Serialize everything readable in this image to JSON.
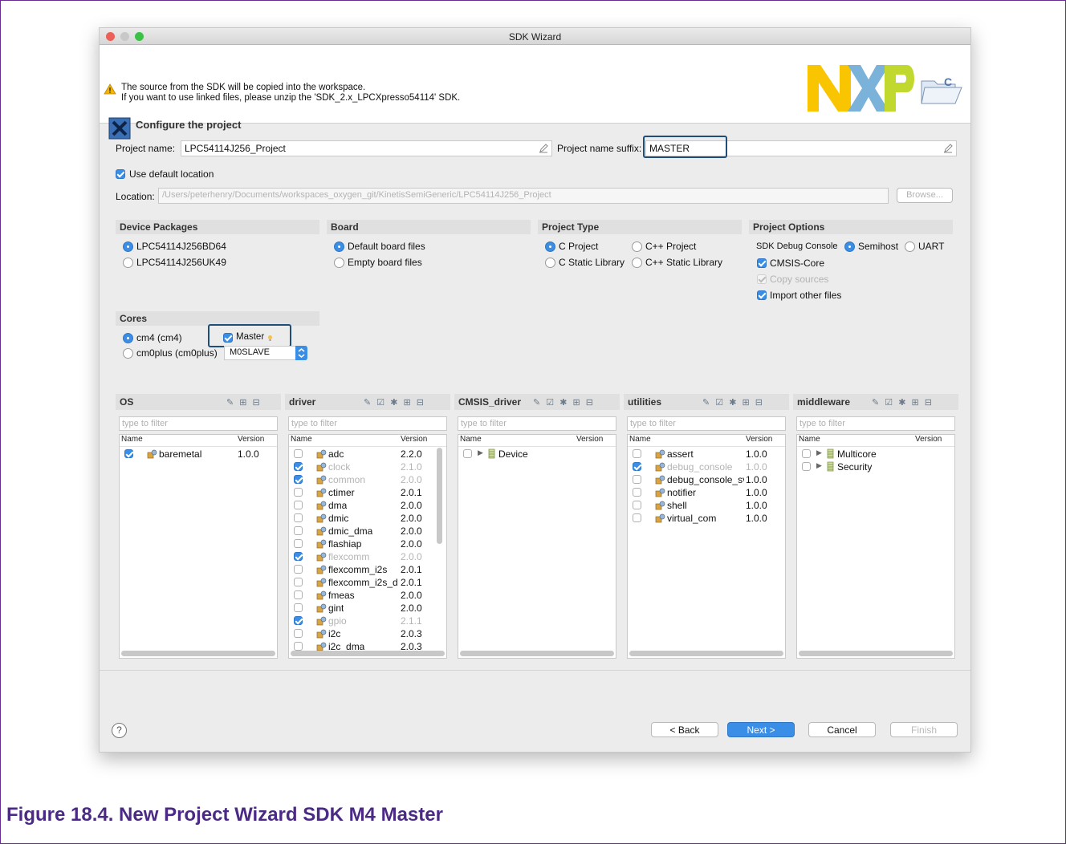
{
  "window": {
    "title": "SDK Wizard"
  },
  "banner": {
    "warning_line1": "The source from the SDK will be copied into the workspace.",
    "warning_line2": "If you want to use linked files, please unzip the 'SDK_2.x_LPCXpresso54114' SDK.",
    "heading": "Configure the project"
  },
  "project": {
    "name_label": "Project name:",
    "name_value": "LPC54114J256_Project",
    "suffix_label": "Project name suffix:",
    "suffix_value": "MASTER",
    "use_default_label": "Use default location",
    "location_label": "Location:",
    "location_value": "/Users/peterhenry/Documents/workspaces_oxygen_git/KinetisSemiGeneric/LPC54114J256_Project",
    "browse_label": "Browse..."
  },
  "device_packages": {
    "title": "Device Packages",
    "options": [
      "LPC54114J256BD64",
      "LPC54114J256UK49"
    ],
    "selected": 0
  },
  "board": {
    "title": "Board",
    "options": [
      "Default board files",
      "Empty board files"
    ],
    "selected": 0
  },
  "project_type": {
    "title": "Project Type",
    "options": [
      "C Project",
      "C++ Project",
      "C Static Library",
      "C++ Static Library"
    ],
    "selected": 0
  },
  "project_options": {
    "title": "Project Options",
    "debug_console_label": "SDK Debug Console",
    "semihost_label": "Semihost",
    "uart_label": "UART",
    "cmsis_core_label": "CMSIS-Core",
    "copy_sources_label": "Copy sources",
    "import_other_label": "Import other files"
  },
  "cores": {
    "title": "Cores",
    "core1": "cm4 (cm4)",
    "core2": "cm0plus (cm0plus)",
    "master_label": "Master",
    "slave_value": "M0SLAVE"
  },
  "panels": {
    "filter_placeholder": "type to filter",
    "name_col": "Name",
    "version_col": "Version",
    "os": {
      "title": "OS",
      "items": [
        {
          "name": "baremetal",
          "version": "1.0.0",
          "checked": true
        }
      ]
    },
    "driver": {
      "title": "driver",
      "items": [
        {
          "name": "adc",
          "version": "2.2.0",
          "checked": false,
          "dim": false
        },
        {
          "name": "clock",
          "version": "2.1.0",
          "checked": true,
          "dim": true
        },
        {
          "name": "common",
          "version": "2.0.0",
          "checked": true,
          "dim": true
        },
        {
          "name": "ctimer",
          "version": "2.0.1",
          "checked": false,
          "dim": false
        },
        {
          "name": "dma",
          "version": "2.0.0",
          "checked": false,
          "dim": false
        },
        {
          "name": "dmic",
          "version": "2.0.0",
          "checked": false,
          "dim": false
        },
        {
          "name": "dmic_dma",
          "version": "2.0.0",
          "checked": false,
          "dim": false
        },
        {
          "name": "flashiap",
          "version": "2.0.0",
          "checked": false,
          "dim": false
        },
        {
          "name": "flexcomm",
          "version": "2.0.0",
          "checked": true,
          "dim": true
        },
        {
          "name": "flexcomm_i2s",
          "version": "2.0.1",
          "checked": false,
          "dim": false
        },
        {
          "name": "flexcomm_i2s_d",
          "version": "2.0.1",
          "checked": false,
          "dim": false
        },
        {
          "name": "fmeas",
          "version": "2.0.0",
          "checked": false,
          "dim": false
        },
        {
          "name": "gint",
          "version": "2.0.0",
          "checked": false,
          "dim": false
        },
        {
          "name": "gpio",
          "version": "2.1.1",
          "checked": true,
          "dim": true
        },
        {
          "name": "i2c",
          "version": "2.0.3",
          "checked": false,
          "dim": false
        },
        {
          "name": "i2c_dma",
          "version": "2.0.3",
          "checked": false,
          "dim": false
        }
      ]
    },
    "cmsis": {
      "title": "CMSIS_driver",
      "items": [
        {
          "name": "Device"
        }
      ]
    },
    "utilities": {
      "title": "utilities",
      "items": [
        {
          "name": "assert",
          "version": "1.0.0",
          "checked": false,
          "dim": false
        },
        {
          "name": "debug_console",
          "version": "1.0.0",
          "checked": true,
          "dim": true
        },
        {
          "name": "debug_console_sv",
          "version": "1.0.0",
          "checked": false,
          "dim": false
        },
        {
          "name": "notifier",
          "version": "1.0.0",
          "checked": false,
          "dim": false
        },
        {
          "name": "shell",
          "version": "1.0.0",
          "checked": false,
          "dim": false
        },
        {
          "name": "virtual_com",
          "version": "1.0.0",
          "checked": false,
          "dim": false
        }
      ]
    },
    "middleware": {
      "title": "middleware",
      "items": [
        {
          "name": "Multicore"
        },
        {
          "name": "Security"
        }
      ]
    }
  },
  "buttons": {
    "help": "?",
    "back": "< Back",
    "next": "Next >",
    "cancel": "Cancel",
    "finish": "Finish"
  },
  "caption": "Figure 18.4. New Project Wizard SDK M4 Master",
  "colors": {
    "accent": "#3b8ee5",
    "highlight_box": "#1f4e79",
    "caption": "#4b2a86",
    "nxp_yellow": "#f9c500",
    "nxp_green": "#c1d82f"
  }
}
